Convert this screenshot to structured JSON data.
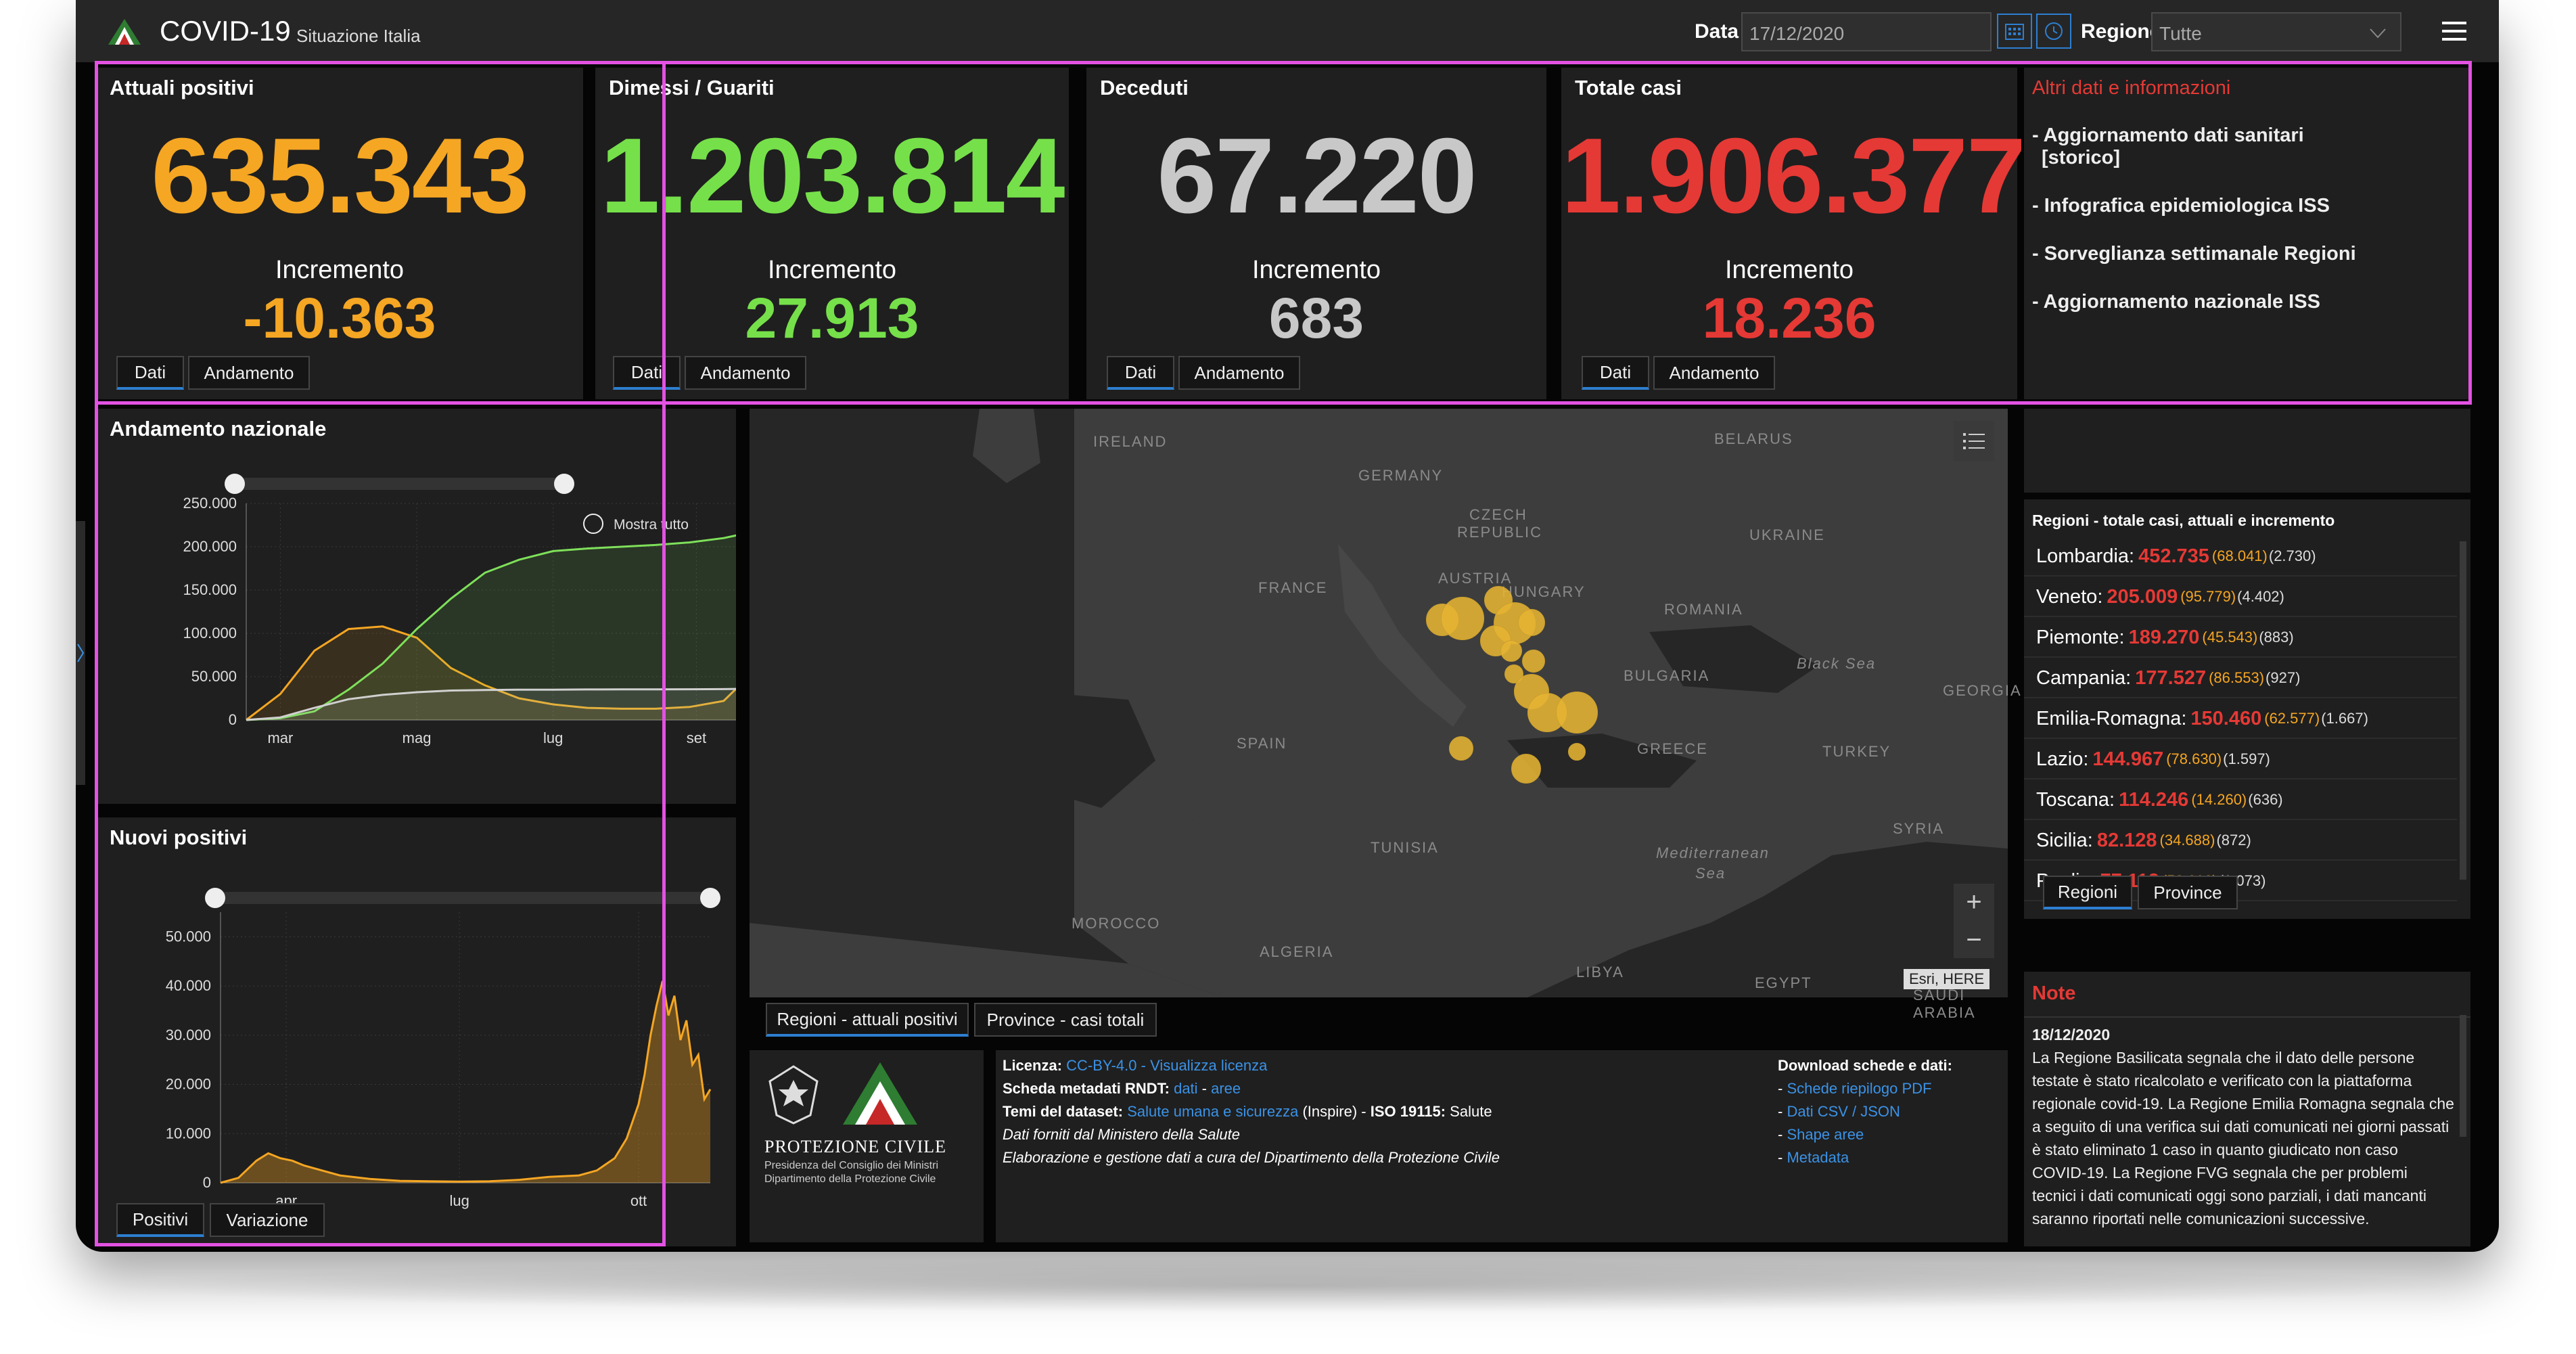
{
  "header": {
    "title": "COVID-19",
    "subtitle": "Situazione Italia",
    "date_label": "Data",
    "date_value": "17/12/2020",
    "region_label": "Regione",
    "region_value": "Tutte"
  },
  "stats": [
    {
      "title": "Attuali positivi",
      "value": "635.343",
      "inc_label": "Incremento",
      "inc": "-10.363",
      "color": "#f5a623",
      "tab1": "Dati",
      "tab2": "Andamento"
    },
    {
      "title": "Dimessi / Guariti",
      "value": "1.203.814",
      "inc_label": "Incremento",
      "inc": "27.913",
      "color": "#76e04a",
      "tab1": "Dati",
      "tab2": "Andamento"
    },
    {
      "title": "Deceduti",
      "value": "67.220",
      "inc_label": "Incremento",
      "inc": "683",
      "color": "#c8c8c8",
      "tab1": "Dati",
      "tab2": "Andamento"
    },
    {
      "title": "Totale casi",
      "value": "1.906.377",
      "inc_label": "Incremento",
      "inc": "18.236",
      "color": "#e53935",
      "tab1": "Dati",
      "tab2": "Andamento"
    }
  ],
  "info": {
    "title": "Altri dati e informazioni",
    "links": [
      "- Aggiornamento dati sanitari",
      "[storico]",
      "- Infografica epidemiologica ISS",
      "- Sorveglianza settimanale Regioni",
      "- Aggiornamento nazionale ISS"
    ]
  },
  "andamento": {
    "title": "Andamento nazionale",
    "zoom_label": "Mostra tutto"
  },
  "nuovi": {
    "title": "Nuovi positivi",
    "tab1": "Positivi",
    "tab2": "Variazione"
  },
  "map": {
    "labels": [
      "IRELAND",
      "GERMANY",
      "BELARUS",
      "CZECH",
      "REPUBLIC",
      "UKRAINE",
      "FRANCE",
      "AUSTRIA",
      "HUNGARY",
      "ROMANIA",
      "Black Sea",
      "BULGARIA",
      "GEORGIA",
      "SPAIN",
      "GREECE",
      "TURKEY",
      "SYRIA",
      "TUNISIA",
      "Mediterranean",
      "Sea",
      "MOROCCO",
      "ALGERIA",
      "LIBYA",
      "EGYPT",
      "SAUDI ARABIA"
    ],
    "attribution": "Esri, HERE",
    "zoom_in": "+",
    "zoom_out": "−",
    "tab1": "Regioni - attuali positivi",
    "tab2": "Province - casi totali"
  },
  "regions": {
    "title": "Regioni - totale casi, attuali e incremento",
    "rows": [
      {
        "name": "Lombardia:",
        "tot": "452.735",
        "att": "(68.041)",
        "inc": "(2.730)"
      },
      {
        "name": "Veneto:",
        "tot": "205.009",
        "att": "(95.779)",
        "inc": "(4.402)"
      },
      {
        "name": "Piemonte:",
        "tot": "189.270",
        "att": "(45.543)",
        "inc": "(883)"
      },
      {
        "name": "Campania:",
        "tot": "177.527",
        "att": "(86.553)",
        "inc": "(927)"
      },
      {
        "name": "Emilia-Romagna:",
        "tot": "150.460",
        "att": "(62.577)",
        "inc": "(1.667)"
      },
      {
        "name": "Lazio:",
        "tot": "144.967",
        "att": "(78.630)",
        "inc": "(1.597)"
      },
      {
        "name": "Toscana:",
        "tot": "114.246",
        "att": "(14.260)",
        "inc": "(636)"
      },
      {
        "name": "Sicilia:",
        "tot": "82.128",
        "att": "(34.688)",
        "inc": "(872)"
      },
      {
        "name": "Puglia:",
        "tot": "77.112",
        "att": "(52.616)",
        "inc": "(1.073)"
      }
    ],
    "tab1": "Regioni",
    "tab2": "Province"
  },
  "note": {
    "title": "Note",
    "date": "18/12/2020",
    "text": "La Regione Basilicata segnala che il dato delle persone testate è stato ricalcolato e verificato con la piattaforma regionale covid-19. La Regione Emilia Romagna segnala che a seguito di una verifica sui dati comunicati nei giorni passati è stato eliminato 1 caso in quanto giudicato non caso COVID-19. La Regione FVG segnala che per problemi tecnici i dati comunicati oggi sono parziali, i dati mancanti saranno riportati nelle comunicazioni successive."
  },
  "footer": {
    "logo_name": "PROTEZIONE CIVILE",
    "logo_sub1": "Presidenza del Consiglio dei Ministri",
    "logo_sub2": "Dipartimento della Protezione Civile",
    "licenza_label": "Licenza:",
    "licenza_link": "CC-BY-4.0",
    "licenza_sep": " - ",
    "licenza_view": "Visualizza licenza",
    "scheda_label": "Scheda metadati RNDT:",
    "scheda_dati": "dati",
    "scheda_sep": " - ",
    "scheda_aree": "aree",
    "temi_label": "Temi del dataset:",
    "temi_link": "Salute umana e sicurezza",
    "temi_rest": "(Inspire) -",
    "iso_label": "ISO 19115:",
    "iso_val": "Salute",
    "line4": "Dati forniti dal Ministero della Salute",
    "line5": "Elaborazione e gestione dati a cura del Dipartimento della Protezione Civile",
    "download_title": "Download schede e dati:",
    "downloads": [
      "Schede riepilogo PDF",
      "Dati CSV / JSON",
      "Shape aree",
      "Metadata"
    ]
  },
  "chart_data": [
    {
      "type": "line",
      "title": "Andamento nazionale",
      "x_tick_labels": [
        "mar",
        "mag",
        "lug",
        "set"
      ],
      "y_tick_labels": [
        "0",
        "50.000",
        "100.000",
        "150.000",
        "200.000",
        "250.000"
      ],
      "ylim": [
        0,
        250000
      ],
      "x_months": [
        2.0,
        2.5,
        3.0,
        3.5,
        4.0,
        4.5,
        5.0,
        5.5,
        6.0,
        6.5,
        7.0,
        7.5,
        8.0,
        8.5,
        9.0,
        9.3
      ],
      "series": [
        {
          "color": "#f5a623",
          "values": [
            0,
            30000,
            80000,
            105000,
            108000,
            95000,
            60000,
            40000,
            25000,
            18000,
            14000,
            13000,
            13000,
            15000,
            22000,
            45000
          ]
        },
        {
          "color": "#7ee05a",
          "values": [
            0,
            2000,
            10000,
            35000,
            65000,
            105000,
            140000,
            170000,
            185000,
            195000,
            198000,
            200000,
            202000,
            205000,
            210000,
            215000
          ]
        },
        {
          "color": "#d0d0d0",
          "values": [
            0,
            3000,
            14000,
            24000,
            29000,
            32000,
            34000,
            34500,
            35000,
            35000,
            35200,
            35300,
            35400,
            35500,
            35600,
            36000
          ]
        }
      ],
      "grid": true
    },
    {
      "type": "area",
      "title": "Nuovi positivi",
      "x_tick_labels": [
        "apr",
        "lug",
        "ott"
      ],
      "y_tick_labels": [
        "0",
        "10.000",
        "20.000",
        "30.000",
        "40.000",
        "50.000"
      ],
      "ylim": [
        0,
        55000
      ],
      "x_months": [
        2.0,
        2.3,
        2.6,
        2.8,
        3.0,
        3.2,
        3.4,
        3.7,
        4.0,
        4.5,
        5.0,
        5.5,
        6.0,
        6.5,
        7.0,
        7.5,
        8.0,
        8.3,
        8.6,
        8.8,
        9.0,
        9.1,
        9.2,
        9.3,
        9.4,
        9.5,
        9.6,
        9.7,
        9.8,
        9.9,
        10.0,
        10.1,
        10.2
      ],
      "series": [
        {
          "color": "#f5a623",
          "values": [
            0,
            1000,
            4500,
            6000,
            5000,
            4500,
            3500,
            2500,
            1500,
            800,
            400,
            300,
            250,
            300,
            600,
            1200,
            1500,
            2500,
            5000,
            9000,
            16000,
            22000,
            30000,
            36000,
            41000,
            34000,
            38000,
            29000,
            33000,
            24000,
            26000,
            17000,
            19000
          ]
        }
      ],
      "grid": true
    }
  ]
}
